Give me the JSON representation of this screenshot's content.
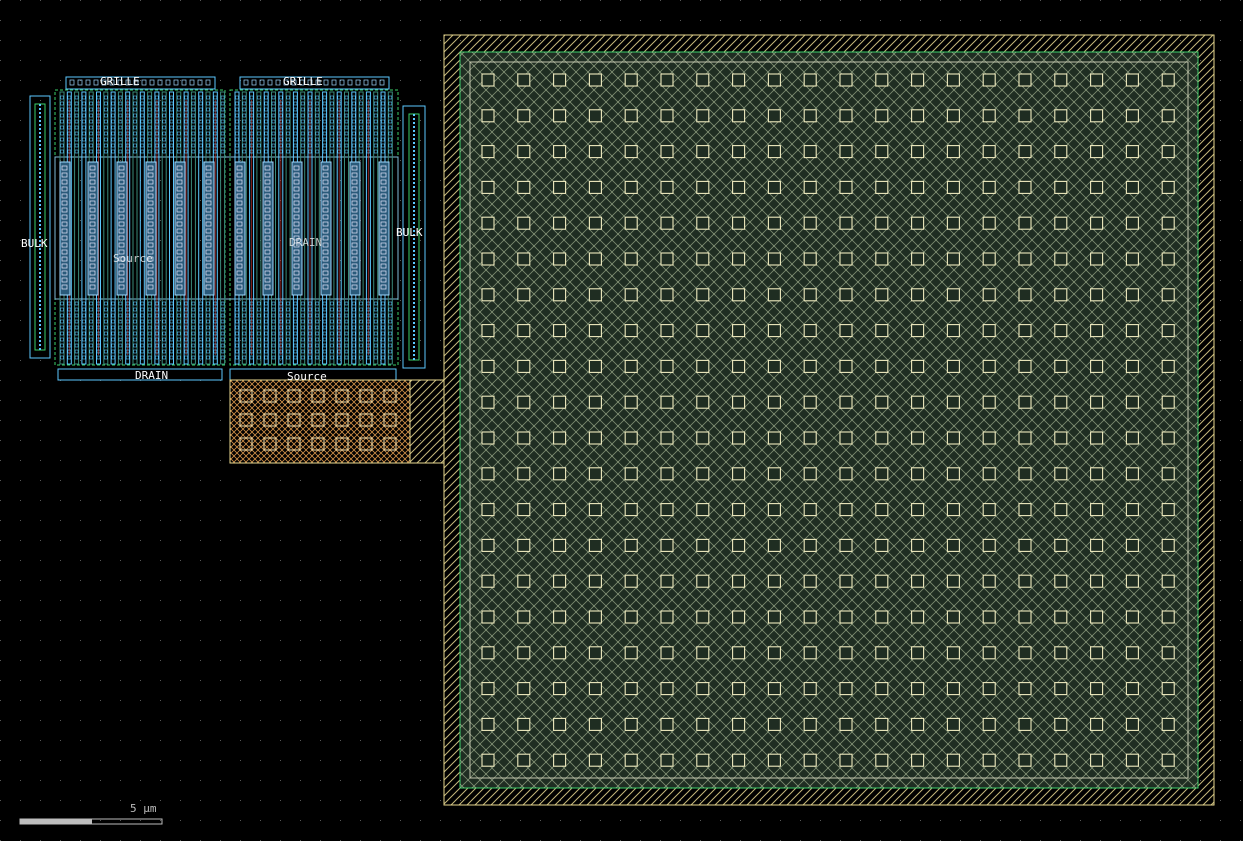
{
  "labels": {
    "gate_left": "GRILLE",
    "gate_right": "GRILLE",
    "bulk_left": "BULK",
    "bulk_right": "BULK",
    "source_inner": "Source",
    "drain_inner": "DRAIN",
    "drain_bottom": "DRAIN",
    "source_bottom": "Source"
  },
  "scale_bar": {
    "label": "5 µm"
  },
  "colors": {
    "background": "#000000",
    "grid_dot": "#5a5a5a",
    "label_text": "#ffffff",
    "poly_gate": "#5cc8ff",
    "active": "#3a8a7a",
    "metal1": "#7fbcd9",
    "contact": "#e8e8ff",
    "metal_red": "#c03030",
    "green_edge": "#3ad06a",
    "pad_outline": "#e8d890",
    "pad_fill": "#1e2a1e",
    "pad_via": "#e8e8b0",
    "pad_green": "#3a7a5a",
    "resistor_orange": "#e8a050",
    "scale_bar_fill": "#bdbdbd"
  },
  "icons": {
    "pad_via": "square-outline-icon"
  }
}
